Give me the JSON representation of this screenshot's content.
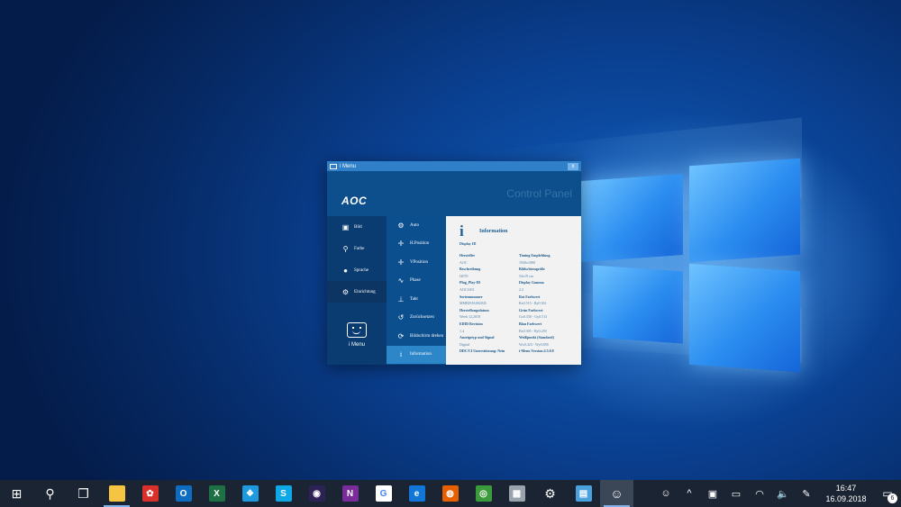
{
  "window": {
    "title": "i Menu",
    "close_glyph": "x",
    "logo": "AOC",
    "header_title": "Control Panel"
  },
  "left_nav": [
    {
      "label": "Bild",
      "icon": "picture-icon"
    },
    {
      "label": "Farbe",
      "icon": "color-icon"
    },
    {
      "label": "Sprache",
      "icon": "speech-icon"
    },
    {
      "label": "Einrichtung",
      "icon": "gear-icon"
    }
  ],
  "imenu_label": "i Menu",
  "sub_nav": [
    {
      "label": "Auto",
      "icon": "gear-icon"
    },
    {
      "label": "H.Position",
      "icon": "h-position-icon"
    },
    {
      "label": "VPosition",
      "icon": "v-position-icon"
    },
    {
      "label": "Phase",
      "icon": "phase-icon"
    },
    {
      "label": "Takt",
      "icon": "clock-signal-icon"
    },
    {
      "label": "Zurücksetzen",
      "icon": "reset-icon"
    },
    {
      "label": "Bildschirm drehen",
      "icon": "rotate-screen-icon"
    },
    {
      "label": "Information",
      "icon": "info-icon"
    }
  ],
  "info": {
    "title": "Information",
    "subtitle": "Display ID",
    "rows": [
      [
        "Hersteller",
        "Timing Empfehlung"
      ],
      [
        "AOC",
        "1920x1080"
      ],
      [
        "Beschreibung",
        "Bildschirmgröße"
      ],
      [
        "I4070",
        "54x19 cm"
      ],
      [
        "Plug_Play-ID",
        "Display Gamma"
      ],
      [
        "AOC1601",
        "2.2"
      ],
      [
        "Seriennummer",
        "Rot Farbwert"
      ],
      [
        "MMBJ9JA002045",
        "Rx0.515 - Ry0.361"
      ],
      [
        "Herstellungsdatum",
        "Grün Farbwert"
      ],
      [
        "Week 12,2018",
        "Gx0.330 - Gy0.513"
      ],
      [
        "EDID Revision",
        "Blau Farbwert"
      ],
      [
        "1.4",
        "Bx0.305 - By0.250"
      ],
      [
        "Anzeigetyp und Signal",
        "Weißpunkt (Standard)"
      ],
      [
        "Digital",
        "Wx0.423 - Wy0.858"
      ],
      [
        "DDC/CI Unterstützung: Nein",
        "i-Menu Version:2.5.0.8"
      ]
    ]
  },
  "taskbar": {
    "apps": [
      {
        "name": "start-icon",
        "glyph": "⊞"
      },
      {
        "name": "search-icon",
        "glyph": "⚲"
      },
      {
        "name": "task-view-icon",
        "glyph": "❐"
      },
      {
        "name": "file-explorer-icon",
        "glyph": "",
        "color": "#f5c542"
      },
      {
        "name": "photos-app-icon",
        "glyph": "✿",
        "color": "#d9302a"
      },
      {
        "name": "outlook-icon",
        "glyph": "O",
        "color": "#0f6cc3"
      },
      {
        "name": "excel-icon",
        "glyph": "X",
        "color": "#1d7144"
      },
      {
        "name": "app-blue-icon",
        "glyph": "❖",
        "color": "#1e9be0"
      },
      {
        "name": "skype-icon",
        "glyph": "S",
        "color": "#10a7e6"
      },
      {
        "name": "eclipse-icon",
        "glyph": "◉",
        "color": "#2c2255"
      },
      {
        "name": "onenote-icon",
        "glyph": "N",
        "color": "#7a2c9a"
      },
      {
        "name": "google-icon",
        "glyph": "G",
        "color": "#ffffff"
      },
      {
        "name": "edge-icon",
        "glyph": "e",
        "color": "#1077d8"
      },
      {
        "name": "firefox-icon",
        "glyph": "◍",
        "color": "#e66000"
      },
      {
        "name": "chrome-icon",
        "glyph": "◎",
        "color": "#3b9a3c"
      },
      {
        "name": "app-grey-icon",
        "glyph": "▦",
        "color": "#9aa3ad"
      },
      {
        "name": "settings-icon",
        "glyph": "⚙",
        "color": ""
      },
      {
        "name": "control-app-icon",
        "glyph": "▤",
        "color": "#4aa3df"
      },
      {
        "name": "imenu-taskbar-icon",
        "glyph": "☺",
        "color": ""
      }
    ],
    "time": "16:47",
    "date": "16.09.2018",
    "notification_count": "6"
  }
}
